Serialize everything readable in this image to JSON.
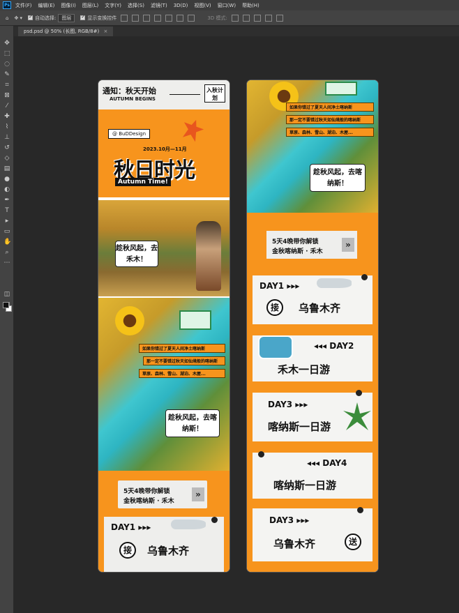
{
  "app": {
    "logo": "Ps",
    "menu": [
      "文件(F)",
      "编辑(E)",
      "图像(I)",
      "图层(L)",
      "文字(Y)",
      "选择(S)",
      "滤镜(T)",
      "3D(D)",
      "视图(V)",
      "窗口(W)",
      "帮助(H)"
    ]
  },
  "options": {
    "auto_select_label": "自动选择:",
    "auto_select_value": "图层",
    "show_transform_label": "显示变换控件",
    "mode_3d_label": "3D 模式:"
  },
  "document_tab": {
    "title": "psd.psd @ 50% (长图, RGB/8#)",
    "close": "×"
  },
  "artboard1": {
    "notice_title": "通知：秋天开始",
    "notice_sub": "AUTUMN BEGINS",
    "plan_tag": "入秋计划",
    "handle": "@ BuDDesign",
    "date": "2023.10月—11月",
    "headline": "秋日时光",
    "headline_en": "Autumn Time!",
    "bubble1": "趁秋风起，去禾木！",
    "strip1": "如果你错过了夏天人间净土喀纳斯",
    "strip2": "那一定不要错过秋天如仙境般的喀纳斯",
    "strip3": "草原、森林、雪山、湖泊、木屋...",
    "bubble2": "趁秋风起，去喀纳斯！",
    "unlock_line1": "5天4晚带你解锁",
    "unlock_line2": "金秋喀纳斯 · 禾木",
    "day1_label": "DAY1 ▸▸▸",
    "pickup_badge": "接",
    "day1_place": "乌鲁木齐"
  },
  "artboard2": {
    "strip1": "如果你错过了夏天人间净土喀纳斯",
    "strip2": "那一定不要错过秋天如仙境般的喀纳斯",
    "strip3": "草原、森林、雪山、湖泊、木屋...",
    "bubble": "趁秋风起，去喀纳斯！",
    "unlock_line1": "5天4晚带你解锁",
    "unlock_line2": "金秋喀纳斯 · 禾木",
    "days": [
      {
        "label": "DAY1 ▸▸▸",
        "place": "乌鲁木齐",
        "badge": "接"
      },
      {
        "label": "◂◂◂ DAY2",
        "place": "禾木一日游",
        "badge": ""
      },
      {
        "label": "DAY3 ▸▸▸",
        "place": "喀纳斯一日游",
        "badge": ""
      },
      {
        "label": "◂◂◂ DAY4",
        "place": "喀纳斯一日游",
        "badge": ""
      },
      {
        "label": "DAY3 ▸▸▸",
        "place": "乌鲁木齐",
        "badge": "送"
      }
    ]
  },
  "colors": {
    "accent_orange": "#f7941d",
    "paper": "#eeeeec",
    "ui_dark": "#282828",
    "ui_panel": "#434343"
  }
}
